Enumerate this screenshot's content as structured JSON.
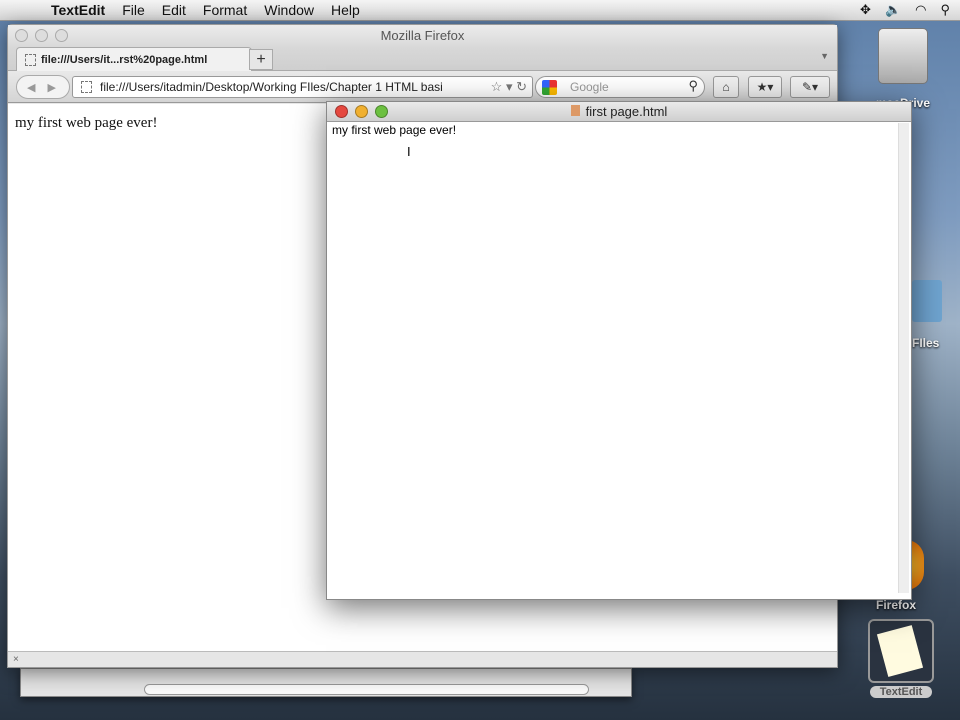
{
  "menubar": {
    "app": "TextEdit",
    "items": [
      "File",
      "Edit",
      "Format",
      "Window",
      "Help"
    ]
  },
  "firefox": {
    "title": "Mozilla Firefox",
    "tab_label": "file:///Users/it...rst%20page.html",
    "new_tab": "+",
    "url": "file:///Users/itadmin/Desktop/Working FIles/Chapter 1 HTML basi",
    "search_placeholder": "Google",
    "page_text": "my first web page ever!",
    "status_close": "×"
  },
  "textedit": {
    "title": "first page.html",
    "document_text": "my first web page ever!"
  },
  "desktop": {
    "icons": [
      "macDrive",
      "FIles",
      "Firefox",
      "TextEdit"
    ]
  }
}
